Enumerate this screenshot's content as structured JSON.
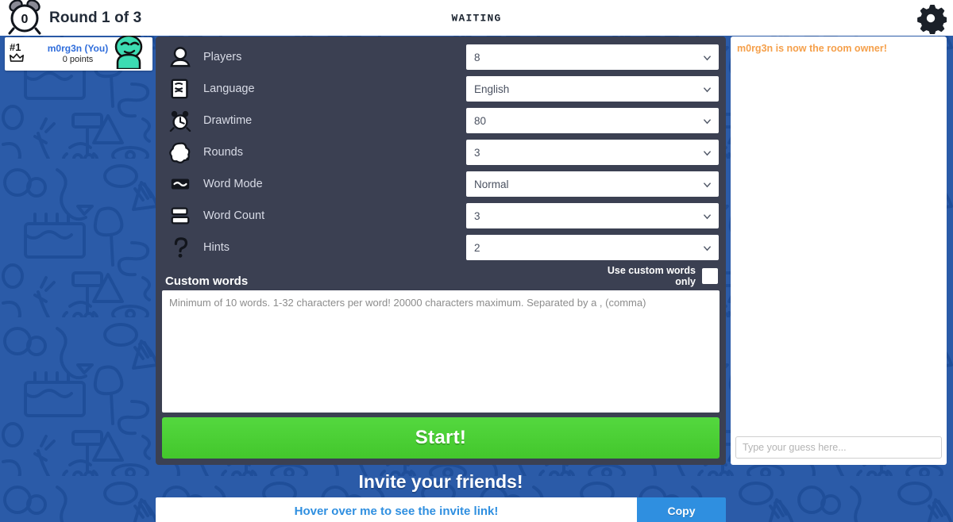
{
  "topbar": {
    "timer_value": "0",
    "round_label": "Round 1 of 3",
    "status": "WAITING",
    "timer_icon": "alarm-clock-icon",
    "settings_icon": "gear-icon"
  },
  "players": [
    {
      "rank": "#1",
      "name": "m0rg3n (You)",
      "score": "0 points",
      "is_owner": true,
      "name_color": "#2f6ddb",
      "avatar_color": "#3ddcb2"
    }
  ],
  "settings": {
    "rows": [
      {
        "icon": "person-icon",
        "label": "Players",
        "value": "8"
      },
      {
        "icon": "language-icon",
        "label": "Language",
        "value": "English"
      },
      {
        "icon": "alarm-clock-icon",
        "label": "Drawtime",
        "value": "80"
      },
      {
        "icon": "splat-icon",
        "label": "Rounds",
        "value": "3"
      },
      {
        "icon": "word-mode-icon",
        "label": "Word Mode",
        "value": "Normal"
      },
      {
        "icon": "word-count-icon",
        "label": "Word Count",
        "value": "3"
      },
      {
        "icon": "question-mark-icon",
        "label": "Hints",
        "value": "2"
      }
    ],
    "custom_words": {
      "title": "Custom words",
      "toggle_label": "Use custom words only",
      "toggle_checked": false,
      "placeholder": "Minimum of 10 words. 1-32 characters per word! 20000 characters maximum. Separated by a , (comma)",
      "value": ""
    },
    "start_label": "Start!"
  },
  "chat": {
    "messages": [
      {
        "text": "m0rg3n is now the room owner!",
        "color": "#f5a04b"
      }
    ],
    "input_placeholder": "Type your guess here...",
    "input_value": ""
  },
  "invite": {
    "title": "Invite your friends!",
    "link_text": "Hover over me to see the invite link!",
    "copy_label": "Copy"
  },
  "colors": {
    "background_blue": "#2b5ba8",
    "doodle_stroke": "#1f4e99",
    "panel_dark": "#3b4052",
    "start_green": "#4cd137",
    "accent_blue": "#2f8fe0"
  }
}
